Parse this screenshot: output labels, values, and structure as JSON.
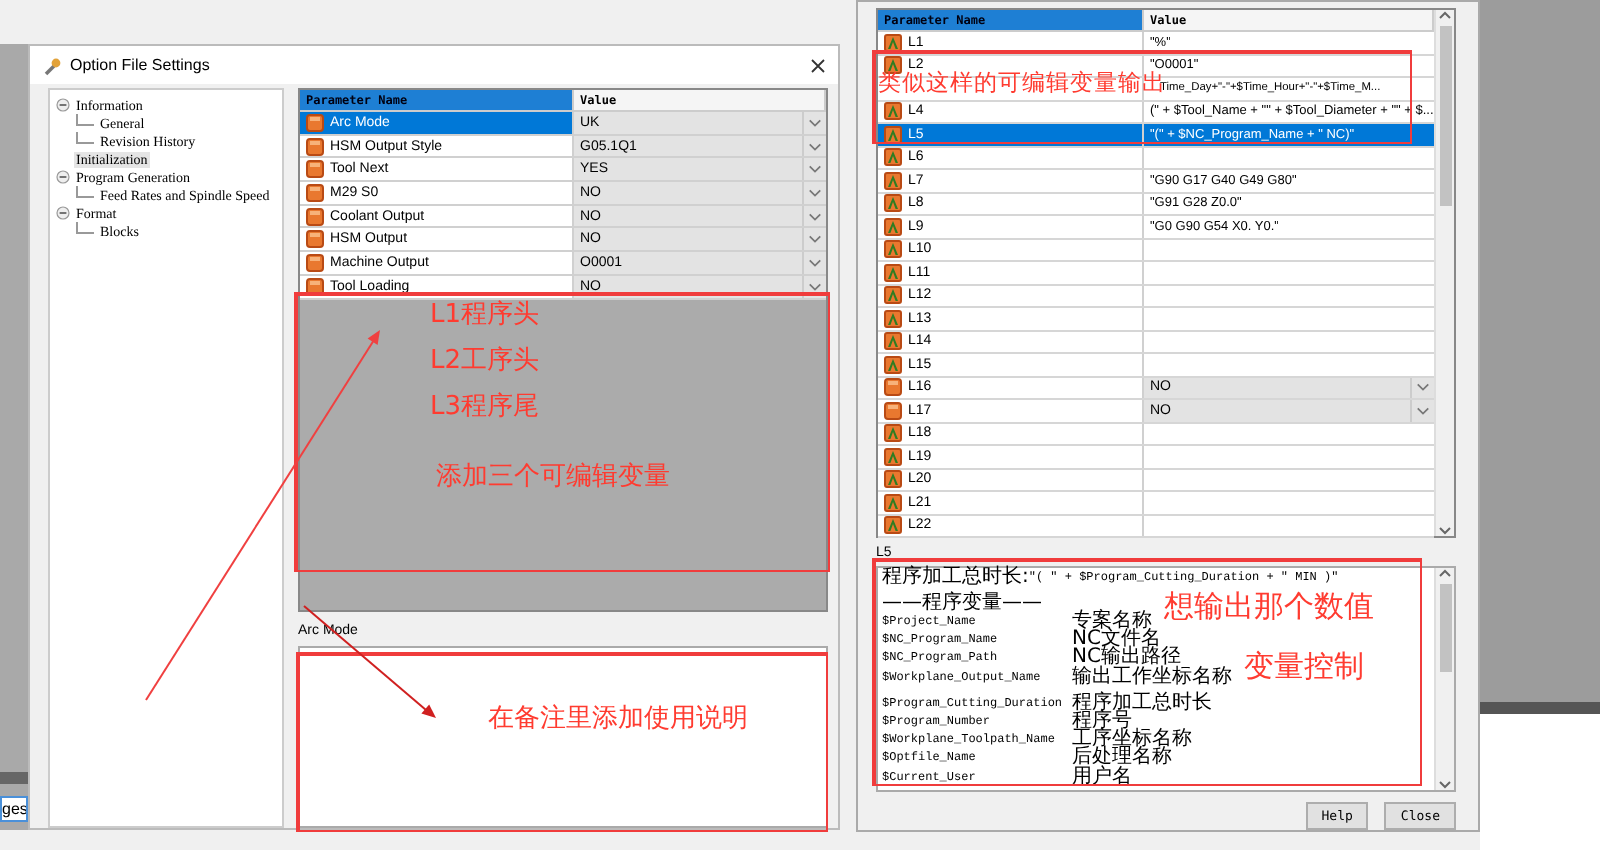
{
  "left_tab": "ges",
  "left_window": {
    "title": "Option File Settings"
  },
  "tree": [
    {
      "label": "Information",
      "expanded": true,
      "selected": false,
      "children": [
        {
          "label": "General",
          "selected": false
        },
        {
          "label": "Revision History",
          "selected": false
        }
      ]
    },
    {
      "label": "Initialization",
      "selected": true
    },
    {
      "label": "Program Generation",
      "expanded": true,
      "selected": false,
      "children": [
        {
          "label": "Feed Rates and Spindle Speed",
          "selected": false
        }
      ]
    },
    {
      "label": "Format",
      "expanded": true,
      "selected": false,
      "children": [
        {
          "label": "Blocks",
          "selected": false
        }
      ]
    }
  ],
  "parameters": {
    "columns": [
      "Parameter Name",
      "Value"
    ],
    "rows": [
      {
        "name": "Arc Mode",
        "value": "UK",
        "selected": true
      },
      {
        "name": "HSM Output Style",
        "value": "G05.1Q1",
        "selected": false
      },
      {
        "name": "Tool Next",
        "value": "YES",
        "selected": false
      },
      {
        "name": "M29 S0",
        "value": "NO",
        "selected": false
      },
      {
        "name": "Coolant Output",
        "value": "NO",
        "selected": false
      },
      {
        "name": "HSM Output",
        "value": "NO",
        "selected": false
      },
      {
        "name": "Machine Output",
        "value": "O0001",
        "selected": false
      },
      {
        "name": "Tool Loading",
        "value": "NO",
        "selected": false
      }
    ]
  },
  "description_label": "Arc Mode",
  "right_window": {
    "columns": [
      "Parameter Name",
      "Value"
    ],
    "rows": [
      {
        "kind": "text",
        "name": "L1",
        "value": "\"%\"",
        "selected": false
      },
      {
        "kind": "text",
        "name": "L2",
        "value": "\"O0001\"",
        "selected": false
      },
      {
        "kind": "text",
        "value": "Time_Day+\"-\"+$Time_Hour+\"-\"+$Time_M...",
        "selected": false
      },
      {
        "kind": "text",
        "name": "L4",
        "value": "(\" + $Tool_Name + \"\" + $Tool_Diameter + \"\" + $...",
        "selected": false
      },
      {
        "kind": "text",
        "name": "L5",
        "value": "\"(\" + $NC_Program_Name + \" NC)\"",
        "selected": true
      },
      {
        "kind": "text",
        "name": "L6",
        "selected": false
      },
      {
        "kind": "text",
        "name": "L7",
        "value": "\"G90 G17 G40 G49 G80\"",
        "selected": false
      },
      {
        "kind": "text",
        "name": "L8",
        "value": "\"G91 G28  Z0.0\"",
        "selected": false
      },
      {
        "kind": "text",
        "name": "L9",
        "value": "\"G0 G90 G54 X0. Y0.\"",
        "selected": false
      },
      {
        "kind": "text",
        "name": "L10",
        "selected": false
      },
      {
        "kind": "text",
        "name": "L11",
        "selected": false
      },
      {
        "kind": "text",
        "name": "L12",
        "selected": false
      },
      {
        "kind": "text",
        "name": "L13",
        "selected": false
      },
      {
        "kind": "text",
        "name": "L14",
        "selected": false
      },
      {
        "kind": "text",
        "name": "L15",
        "selected": false
      },
      {
        "kind": "choice",
        "name": "L16",
        "value": "NO",
        "selected": false
      },
      {
        "kind": "choice",
        "name": "L17",
        "value": "NO",
        "selected": false
      },
      {
        "kind": "text",
        "name": "L18",
        "selected": false
      },
      {
        "kind": "text",
        "name": "L19",
        "selected": false
      },
      {
        "kind": "text",
        "name": "L20",
        "selected": false
      },
      {
        "kind": "text",
        "name": "L21",
        "selected": false
      },
      {
        "kind": "text",
        "name": "L22",
        "selected": false
      }
    ],
    "selected_label": "L5",
    "notes": [
      {
        "kind": "formula",
        "label": "程序加工总时长:",
        "value": "\"( \" + $Program_Cutting_Duration + \" MIN )\""
      },
      {
        "kind": "blank"
      },
      {
        "kind": "heading",
        "text": "——程序变量——"
      },
      {
        "kind": "var",
        "name": "$Project_Name",
        "desc": "专案名称"
      },
      {
        "kind": "var",
        "name": "$NC_Program_Name",
        "desc": "NC文件名"
      },
      {
        "kind": "var",
        "name": "$NC_Program_Path",
        "desc": "NC输出路径"
      },
      {
        "kind": "var",
        "name": "$Workplane_Output_Name",
        "desc": "输出工作坐标名称"
      },
      {
        "kind": "blank"
      },
      {
        "kind": "var",
        "name": "$Program_Cutting_Duration",
        "desc": "程序加工总时长"
      },
      {
        "kind": "var",
        "name": "$Program_Number",
        "desc": "程序号"
      },
      {
        "kind": "var",
        "name": "$Workplane_Toolpath_Name",
        "desc": "工序坐标名称"
      },
      {
        "kind": "var",
        "name": "$Optfile_Name",
        "desc": "后处理名称"
      },
      {
        "kind": "var",
        "name": "$Current_User",
        "desc": "用户名"
      }
    ],
    "buttons": [
      "Help",
      "Close"
    ]
  },
  "annotations": {
    "left_box": [
      "L1程序头",
      "L2工序头",
      "L3程序尾",
      "添加三个可编辑变量"
    ],
    "left_note": "在备注里添加使用说明",
    "right_title": "类似这样的可编辑变量输出",
    "right_notes": [
      "想输出那个数值",
      "变量控制"
    ]
  }
}
